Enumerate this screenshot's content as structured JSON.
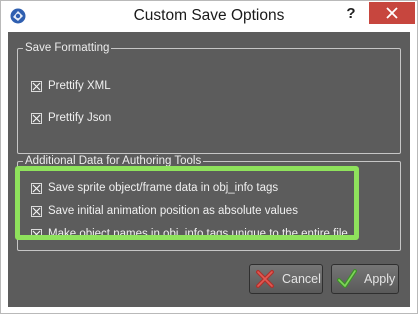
{
  "window": {
    "title": "Custom Save Options",
    "help_label": "?",
    "close_icon": "close-icon"
  },
  "save_formatting": {
    "title": "Save Formatting",
    "options": [
      {
        "label": "Prettify XML",
        "checked": true
      },
      {
        "label": "Prettify Json",
        "checked": true
      }
    ]
  },
  "authoring": {
    "title": "Additional Data for Authoring Tools",
    "options": [
      {
        "label": "Save sprite object/frame data in obj_info tags",
        "checked": true
      },
      {
        "label": "Save initial animation position as absolute values",
        "checked": true
      },
      {
        "label": "Make object names in obj_info tags unique to the entire file",
        "checked": true
      }
    ]
  },
  "buttons": {
    "cancel": "Cancel",
    "apply": "Apply"
  },
  "colors": {
    "highlight": "#8fe25c",
    "client_bg": "#5c5c5c",
    "close_bg": "#c7463e"
  }
}
